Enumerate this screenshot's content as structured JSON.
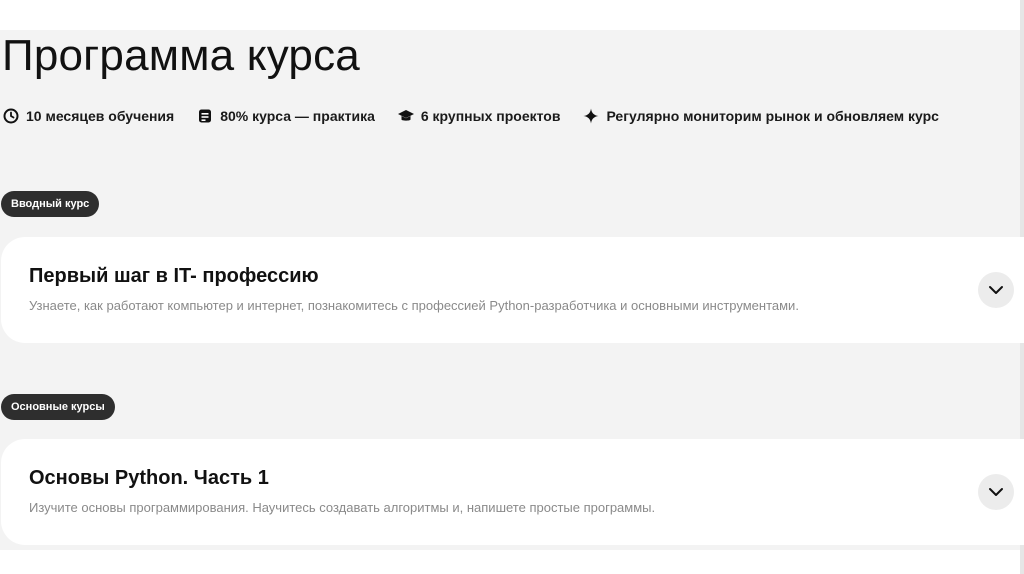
{
  "heading": "Программа курса",
  "features": [
    {
      "icon": "clock-icon",
      "label": "10 месяцев обучения"
    },
    {
      "icon": "document-icon",
      "label": "80% курса — практика"
    },
    {
      "icon": "graduation-cap-icon",
      "label": "6 крупных проектов"
    },
    {
      "icon": "sparkle-icon",
      "label": "Регулярно мониторим рынок и обновляем курс"
    }
  ],
  "sections": [
    {
      "tag": "Вводный курс",
      "title": "Первый шаг в IT- профессию",
      "description": "Узнаете, как работают компьютер и интернет, познакомитесь с профессией Python-разработчика и основными инструментами.",
      "expand_icon": "chevron-down-icon"
    },
    {
      "tag": "Основные курсы",
      "title": "Основы Python. Часть 1",
      "description": "Изучите основы программирования. Научитесь создавать алгоритмы и, напишете простые программы.",
      "expand_icon": "chevron-down-icon"
    }
  ],
  "colors": {
    "background": "#f3f3f3",
    "card": "#ffffff",
    "pill": "#2e2e2e",
    "muted_text": "#8a8a8a",
    "expand_button": "#ececec"
  }
}
